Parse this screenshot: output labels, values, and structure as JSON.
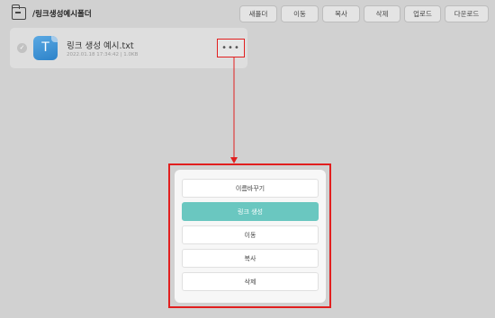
{
  "toolbar": {
    "path": "/링크생성예시폴더",
    "buttons": [
      "새폴더",
      "이동",
      "복사",
      "삭제",
      "업로드",
      "다운로드"
    ]
  },
  "file": {
    "name": "링크 생성 예시.txt",
    "meta": "2022.01.18 17:34:42 | 1.0KB",
    "icon_letter": "T",
    "more_glyph": "•••"
  },
  "popup": {
    "items": [
      {
        "label": "이름바꾸기",
        "primary": false
      },
      {
        "label": "링크 생성",
        "primary": true
      },
      {
        "label": "이동",
        "primary": false
      },
      {
        "label": "복사",
        "primary": false
      },
      {
        "label": "삭제",
        "primary": false
      }
    ]
  },
  "colors": {
    "highlight": "#e11f1f",
    "primary_button": "#6ac7c0",
    "file_icon": "#2c82c9"
  }
}
